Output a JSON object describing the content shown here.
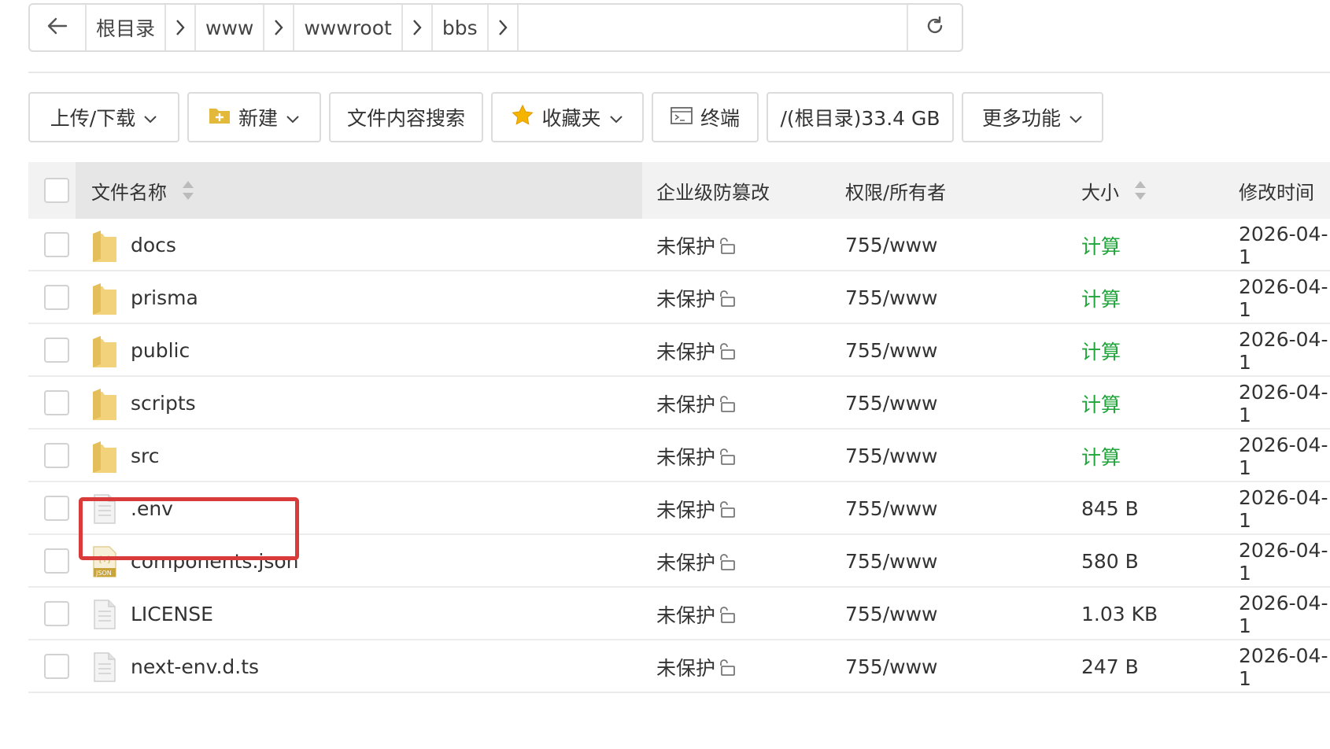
{
  "breadcrumb": {
    "items": [
      "根目录",
      "www",
      "wwwroot",
      "bbs"
    ]
  },
  "toolbar": {
    "upload": "上传/下载",
    "new": "新建",
    "search": "文件内容搜索",
    "favorites": "收藏夹",
    "terminal": "终端",
    "disk": "/(根目录)33.4 GB",
    "more": "更多功能"
  },
  "table": {
    "headers": {
      "name": "文件名称",
      "protect": "企业级防篡改",
      "perm": "权限/所有者",
      "size": "大小",
      "mtime": "修改时间"
    },
    "rows": [
      {
        "name": "docs",
        "type": "folder",
        "protect": "未保护",
        "perm": "755/www",
        "size": "计算",
        "mtime": "2026-04-1"
      },
      {
        "name": "prisma",
        "type": "folder",
        "protect": "未保护",
        "perm": "755/www",
        "size": "计算",
        "mtime": "2026-04-1"
      },
      {
        "name": "public",
        "type": "folder",
        "protect": "未保护",
        "perm": "755/www",
        "size": "计算",
        "mtime": "2026-04-1"
      },
      {
        "name": "scripts",
        "type": "folder",
        "protect": "未保护",
        "perm": "755/www",
        "size": "计算",
        "mtime": "2026-04-1"
      },
      {
        "name": "src",
        "type": "folder",
        "protect": "未保护",
        "perm": "755/www",
        "size": "计算",
        "mtime": "2026-04-1"
      },
      {
        "name": ".env",
        "type": "file",
        "protect": "未保护",
        "perm": "755/www",
        "size": "845 B",
        "mtime": "2026-04-1"
      },
      {
        "name": "components.json",
        "type": "json",
        "protect": "未保护",
        "perm": "755/www",
        "size": "580 B",
        "mtime": "2026-04-1"
      },
      {
        "name": "LICENSE",
        "type": "file",
        "protect": "未保护",
        "perm": "755/www",
        "size": "1.03 KB",
        "mtime": "2026-04-1"
      },
      {
        "name": "next-env.d.ts",
        "type": "file",
        "protect": "未保护",
        "perm": "755/www",
        "size": "247 B",
        "mtime": "2026-04-1"
      }
    ]
  },
  "colors": {
    "calc_green": "#20a53a",
    "highlight_red": "#d93a3a",
    "folder_yellow": "#f2d27a"
  }
}
